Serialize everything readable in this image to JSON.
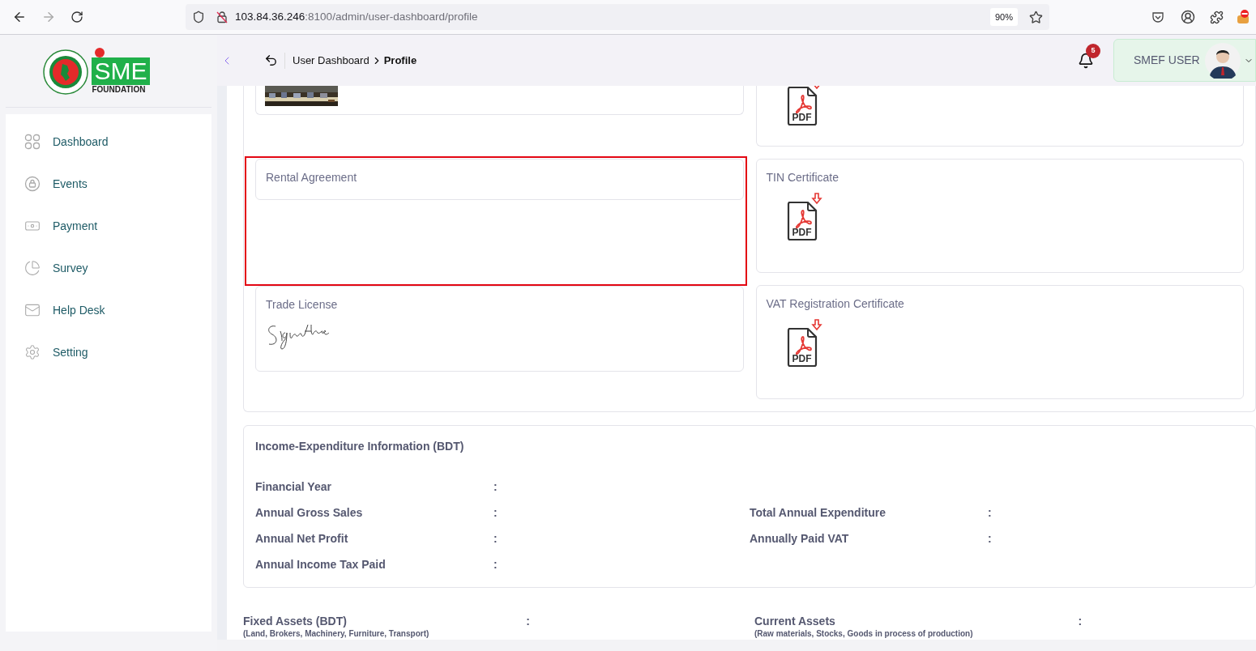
{
  "browser": {
    "url_host": "103.84.36.246",
    "url_path": ":8100/admin/user-dashboard/profile",
    "zoom": "90%"
  },
  "logo": {
    "text": "SME",
    "subtitle": "FOUNDATION"
  },
  "sidebar": {
    "items": [
      {
        "label": "Dashboard",
        "selected": false
      },
      {
        "label": "Events",
        "selected": false
      },
      {
        "label": "Payment",
        "selected": false
      },
      {
        "label": "Survey",
        "selected": false
      },
      {
        "label": "Help Desk",
        "selected": false
      },
      {
        "label": "Setting",
        "selected": false
      }
    ]
  },
  "header": {
    "breadcrumb": [
      "User Dashboard",
      "Profile"
    ],
    "notifications": "5",
    "user": "SMEF USER"
  },
  "documents": {
    "left": [
      {
        "kind": "picture",
        "highlighted": false
      },
      {
        "title": "Rental Agreement",
        "kind": "empty",
        "highlighted": true
      },
      {
        "title": "Trade License",
        "kind": "signature",
        "highlighted": false
      }
    ],
    "right": [
      {
        "kind": "pdf",
        "label": "PDF",
        "highlighted": false
      },
      {
        "title": "TIN Certificate",
        "kind": "pdf",
        "label": "PDF",
        "highlighted": false
      },
      {
        "title": "VAT Registration Certificate",
        "kind": "pdf",
        "label": "PDF",
        "highlighted": false
      }
    ]
  },
  "income": {
    "title": "Income-Expenditure Information (BDT)",
    "rows": [
      {
        "left": {
          "label": "Financial Year",
          "separator": ":"
        }
      },
      {
        "left": {
          "label": "Annual Gross Sales",
          "separator": ":"
        },
        "right": {
          "label": "Total Annual Expenditure",
          "separator": ":"
        }
      },
      {
        "left": {
          "label": "Annual Net Profit",
          "separator": ":"
        },
        "right": {
          "label": "Annually Paid VAT",
          "separator": ":"
        }
      },
      {
        "left": {
          "label": "Annual Income Tax Paid",
          "separator": ":"
        }
      }
    ]
  },
  "assets": [
    {
      "label": "Fixed Assets (BDT)",
      "note": "(Land, Brokers, Machinery, Furniture, Transport)",
      "separator": ":"
    },
    {
      "label": "Current Assets",
      "note": "(Raw materials, Stocks, Goods in process of production)",
      "separator": ":"
    }
  ]
}
